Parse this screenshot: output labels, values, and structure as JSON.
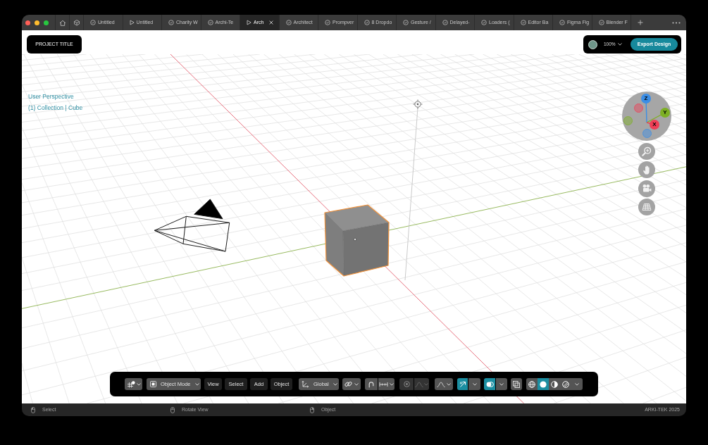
{
  "tabs": [
    {
      "label": "Untitled",
      "kind": "design",
      "selected": false
    },
    {
      "label": "Untitled",
      "kind": "prototype",
      "selected": false
    },
    {
      "label": "Charity W",
      "kind": "design",
      "selected": false
    },
    {
      "label": "Archi-Te",
      "kind": "design",
      "selected": false
    },
    {
      "label": "Arch",
      "kind": "prototype",
      "selected": true
    },
    {
      "label": "Architect",
      "kind": "design",
      "selected": false
    },
    {
      "label": "Prompver",
      "kind": "design",
      "selected": false
    },
    {
      "label": "8 Dropdo",
      "kind": "design",
      "selected": false
    },
    {
      "label": "Gesture /",
      "kind": "design",
      "selected": false
    },
    {
      "label": "Delayed-",
      "kind": "design",
      "selected": false
    },
    {
      "label": "Loaders (",
      "kind": "design",
      "selected": false
    },
    {
      "label": "Editor Ba",
      "kind": "design",
      "selected": false
    },
    {
      "label": "Figma Fig",
      "kind": "design",
      "selected": false
    },
    {
      "label": "Blender F",
      "kind": "design",
      "selected": false
    }
  ],
  "header": {
    "project_title": "PROJECT TITLE",
    "zoom": "100%",
    "export_button": "Export Design"
  },
  "viewport": {
    "view_name": "User Perspective",
    "collection_label": "(1) Collection | Cube",
    "gizmo_axes": [
      {
        "label": "Z",
        "color": "#3b8ee6"
      },
      {
        "label": "Y",
        "color": "#7db024"
      },
      {
        "label": "X",
        "color": "#ef3f57"
      }
    ]
  },
  "toolbar": {
    "mode": "Object Mode",
    "menus": [
      "View",
      "Select",
      "Add",
      "Object"
    ],
    "orientation": "Global",
    "proportional_editing": {
      "disabled": true
    },
    "gizmos": {
      "on": true
    },
    "overlays": {
      "on": true
    },
    "xray": {
      "on": false
    },
    "shading": [
      {
        "selected": false
      },
      {
        "selected": true
      },
      {
        "selected": false
      },
      {
        "selected": false
      }
    ]
  },
  "status_bar": {
    "hints": [
      "Select",
      "Rotate View",
      "Object"
    ],
    "brand": "ARKI-TEK 2025"
  }
}
